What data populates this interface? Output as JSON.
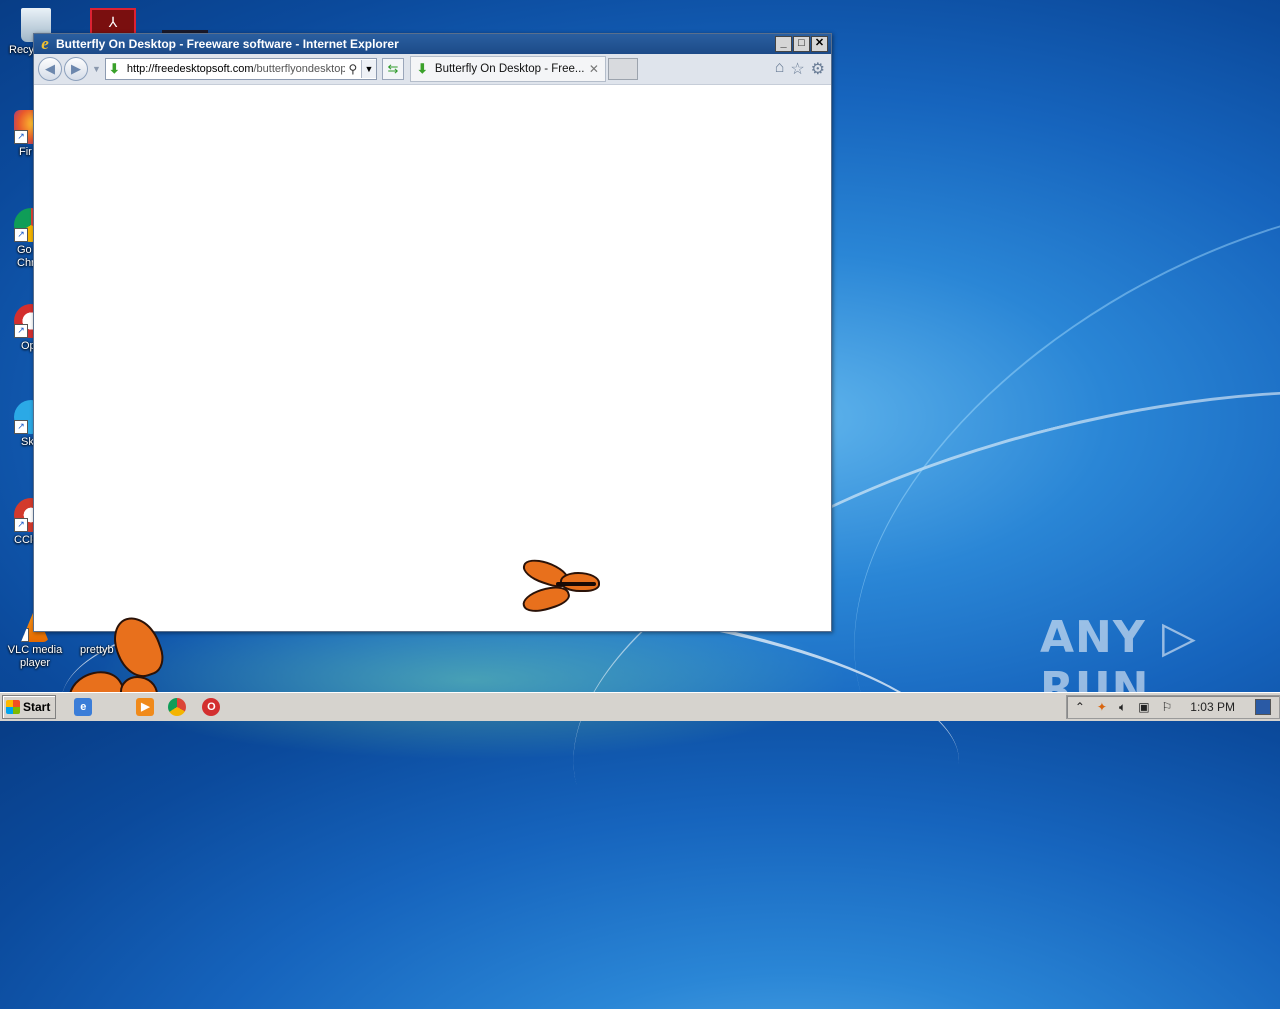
{
  "browser": {
    "window_title": "Butterfly On Desktop - Freeware software - Internet Explorer",
    "address_host": "http://freedesktopsoft.com",
    "address_path": "/butterflyondesktop",
    "tab_label": "Butterfly On Desktop - Free...",
    "window_buttons": {
      "minimize": "_",
      "maximize": "□",
      "close": "✕"
    }
  },
  "desktop": {
    "icons": [
      {
        "label": "Recy",
        "icon": "recycle-bin-icon"
      },
      {
        "label": "Fir",
        "icon": "firefox-icon"
      },
      {
        "label": "Go\nChr",
        "icon": "chrome-icon"
      },
      {
        "label": "Op",
        "icon": "opera-icon"
      },
      {
        "label": "Sk",
        "icon": "skype-icon"
      },
      {
        "label": "CCle",
        "icon": "ccleaner-icon"
      },
      {
        "label": "VLC media\nplayer",
        "icon": "vlc-icon"
      },
      {
        "label": "prettyb",
        "icon": "file-icon"
      }
    ]
  },
  "taskbar": {
    "start_label": "Start",
    "clock": "1:03 PM"
  },
  "watermark": "ANY ▷ RUN",
  "colors": {
    "title_bar": "#1c4a88",
    "desktop": "#1664bd",
    "taskbar": "#d6d3ce"
  }
}
